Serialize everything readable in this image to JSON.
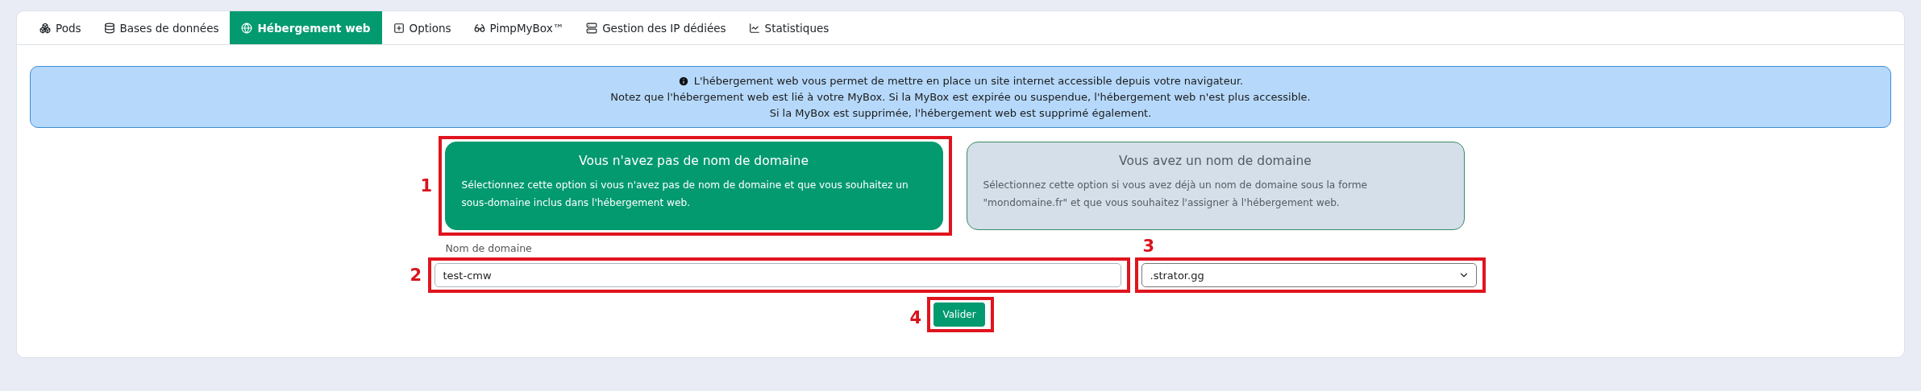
{
  "tabs": [
    {
      "label": "Pods",
      "selected": false
    },
    {
      "label": "Bases de données",
      "selected": false
    },
    {
      "label": "Hébergement web",
      "selected": true
    },
    {
      "label": "Options",
      "selected": false
    },
    {
      "label": "PimpMyBox™",
      "selected": false
    },
    {
      "label": "Gestion des IP dédiées",
      "selected": false
    },
    {
      "label": "Statistiques",
      "selected": false
    }
  ],
  "info": {
    "lines": [
      "L'hébergement web vous permet de mettre en place un site internet accessible depuis votre navigateur.",
      "Notez que l'hébergement web est lié à votre MyBox. Si la MyBox est expirée ou suspendue, l'hébergement web n'est plus accessible.",
      "Si la MyBox est supprimée, l'hébergement web est supprimé également."
    ]
  },
  "domain_options": [
    {
      "title": "Vous n'avez pas de nom de domaine",
      "description": "Sélectionnez cette option si vous n'avez pas de nom de domaine et que vous souhaitez un sous-domaine inclus dans l'hébergement web.",
      "selected": true,
      "annotation": "1"
    },
    {
      "title": "Vous avez un nom de domaine",
      "description": "Sélectionnez cette option si vous avez déjà un nom de domaine sous la forme \"mondomaine.fr\" et que vous souhaitez l'assigner à l'hébergement web.",
      "selected": false
    }
  ],
  "domain_form": {
    "label": "Nom de domaine",
    "value": "test-cmw",
    "value_annotation": "2",
    "suffix": ".strator.gg",
    "suffix_annotation": "3"
  },
  "submit": {
    "label": "Valider",
    "annotation": "4"
  }
}
